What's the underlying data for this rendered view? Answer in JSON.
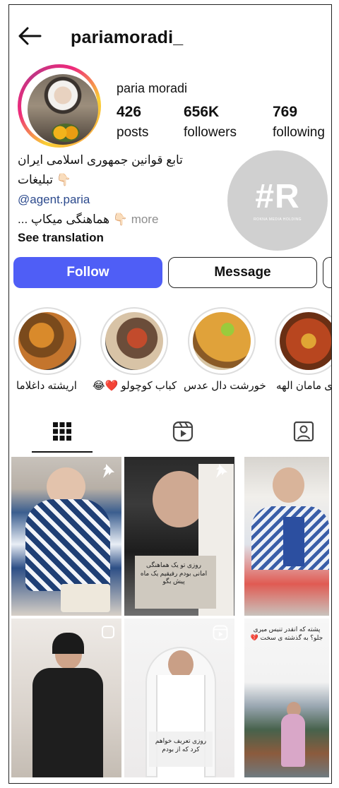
{
  "header": {
    "username": "pariamoradi_"
  },
  "profile": {
    "full_name": "paria moradi",
    "stats": [
      {
        "count": "426",
        "label": "posts"
      },
      {
        "count": "656K",
        "label": "followers"
      },
      {
        "count": "769",
        "label": "following"
      }
    ]
  },
  "bio": {
    "line1": "تابع قوانین جمهوری اسلامی ایران",
    "line2": "👇🏻 تبلیغات",
    "link": "@agent.paria",
    "line4_text": "👇🏻 هماهنگی میکاپ ...",
    "more": "more",
    "see_translation": "See translation"
  },
  "watermark": {
    "main": "#R",
    "sub": "ROKNA MEDIA HOLDING"
  },
  "actions": {
    "follow": "Follow",
    "message": "Message"
  },
  "highlights": [
    {
      "label": "اریشته داغلاما",
      "color": "#b0622a"
    },
    {
      "label": "کباب کوچولو ❤️😂",
      "color": "#8c5a3c"
    },
    {
      "label": "خورشت دال عدس",
      "color": "#e2a53a"
    },
    {
      "label": "ی مامان الهه",
      "color": "#b8461f"
    }
  ],
  "tabs": [
    {
      "icon": "grid-icon",
      "active": true
    },
    {
      "icon": "reels-icon",
      "active": false
    },
    {
      "icon": "tagged-icon",
      "active": false
    }
  ],
  "posts": [
    {
      "icon": "pin-icon",
      "caption": ""
    },
    {
      "icon": "pin-icon",
      "caption": "روزی تو یک هماهنگی امانی بودم رفیقیم یک ماه پیش بگو"
    },
    {
      "icon": "",
      "caption": ""
    },
    {
      "icon": "square-icon",
      "caption": ""
    },
    {
      "icon": "reels-icon",
      "caption": "روزی تعریف خواهم کرد که از بودم"
    },
    {
      "icon": "",
      "caption": "پشته که انقدر تنیس میری جلو؟ به گذشته ی سخت 💔"
    }
  ],
  "colors": {
    "follow_button": "#4f5ef6",
    "link": "#2c4a8d",
    "muted": "#8e8e8e"
  }
}
